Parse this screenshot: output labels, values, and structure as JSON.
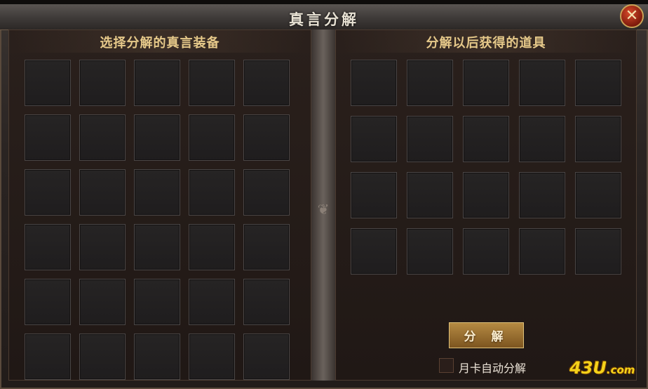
{
  "window": {
    "title": "真言分解",
    "close_icon": "crossed-swords-close-icon"
  },
  "left_panel": {
    "title": "选择分解的真言装备",
    "slot_rows": 6,
    "slot_cols": 5
  },
  "right_panel": {
    "title": "分解以后获得的道具",
    "slot_rows": 4,
    "slot_cols": 5,
    "decompose_button_label": "分 解",
    "auto_decompose_label": "月卡自动分解",
    "auto_decompose_checked": false
  },
  "watermark": {
    "logo_text": "43U",
    "logo_suffix": ".com"
  },
  "colors": {
    "accent_gold": "#e6c98a",
    "button_gold": "#b58a42",
    "close_red": "#d84a2a"
  }
}
